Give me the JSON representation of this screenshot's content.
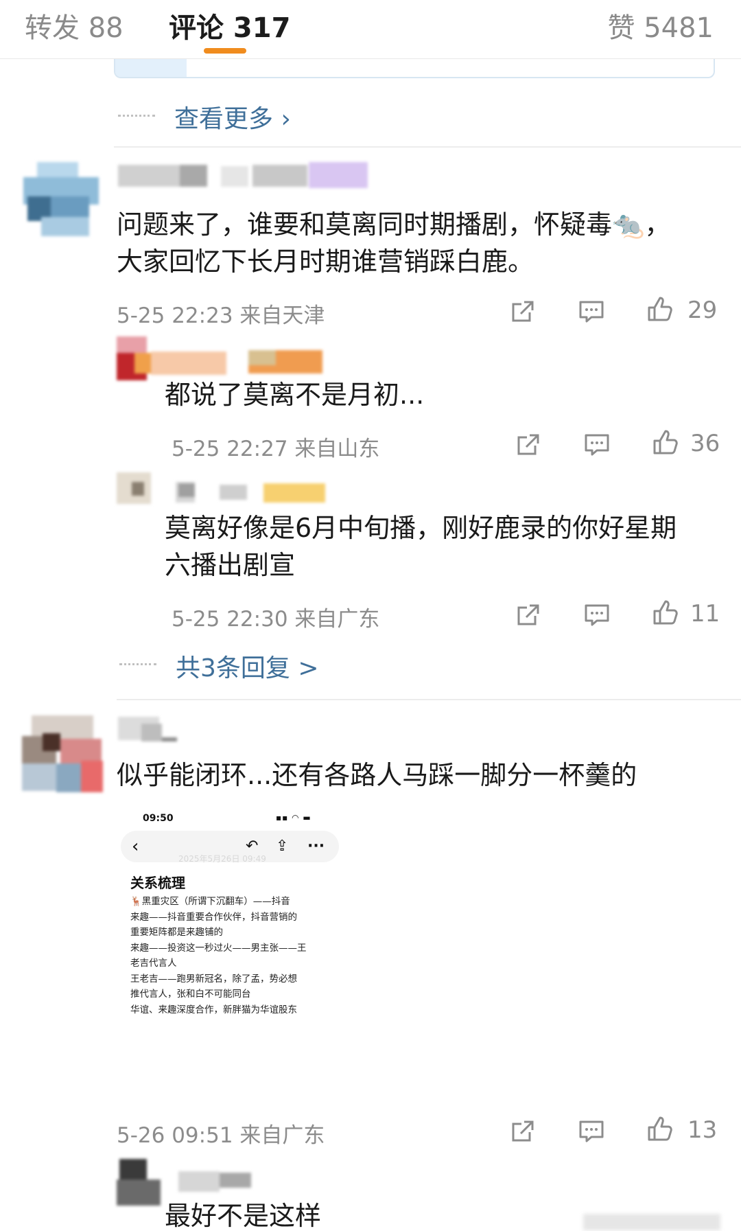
{
  "tabs": {
    "repost": "转发 88",
    "comments": "评论 317",
    "likes": "赞 5481"
  },
  "view_more": "查看更多 ›",
  "comments": [
    {
      "text_lines": [
        "问题来了，谁要和莫离同时期播剧，怀疑毒🐀，",
        "大家回忆下长月时期谁营销踩白鹿。"
      ],
      "meta": "5-25 22:23 来自天津",
      "likes": "29",
      "replies": [
        {
          "text_lines": [
            "都说了莫离不是月初..."
          ],
          "meta": "5-25 22:27 来自山东",
          "likes": "36"
        },
        {
          "text_lines": [
            "莫离好像是6月中旬播，刚好鹿录的你好星期",
            "六播出剧宣"
          ],
          "meta": "5-25 22:30 来自广东",
          "likes": "11"
        }
      ],
      "more_replies": "共3条回复 >"
    },
    {
      "text_lines": [
        "似乎能闭环...还有各路人马踩一脚分一杯羹的"
      ],
      "meta": "5-26 09:51 来自广东",
      "likes": "13",
      "image": {
        "time": "09:50",
        "watermark": "2025年5月26日 09:49",
        "title": "关系梳理",
        "lines": [
          "🦌黑重灾区（所谓下沉翻车）——抖音",
          "来趣——抖音重要合作伙伴，抖音营销的",
          "重要矩阵都是来趣铺的",
          "来趣——投资这一秒过火——男主张——王",
          "老吉代言人",
          "王老吉——跑男新冠名，除了孟，势必想",
          "推代言人，张和白不可能同台",
          "华谊、来趣深度合作，新胖猫为华谊股东"
        ]
      },
      "replies": [
        {
          "text_lines": [
            "最好不是这样"
          ]
        }
      ]
    }
  ],
  "colors": {
    "accent_orange": "#f08c1e",
    "link_blue": "#3f6f99",
    "meta_gray": "#8c8c8c"
  },
  "icons": [
    "share-icon",
    "comment-icon",
    "like-icon",
    "back-icon",
    "undo-icon",
    "more-icon"
  ]
}
